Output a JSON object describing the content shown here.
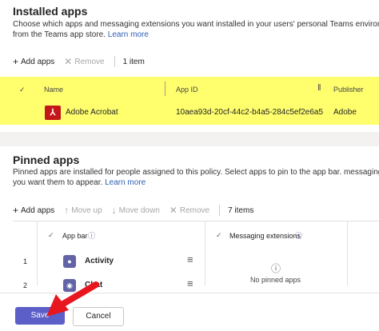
{
  "installed": {
    "title": "Installed apps",
    "desc_line1": "Choose which apps and messaging extensions you want installed in your users' personal Teams environment and",
    "desc_line2": "from the Teams app store.",
    "learn_more": "Learn more",
    "toolbar": {
      "add": "Add apps",
      "remove": "Remove",
      "count": "1 item"
    },
    "columns": {
      "name": "Name",
      "app_id": "App ID",
      "publisher": "Publisher"
    },
    "rows": [
      {
        "name": "Adobe Acrobat",
        "app_id": "10aea93d-20cf-44c2-b4a5-284c5ef2e6a5",
        "publisher": "Adobe"
      }
    ]
  },
  "pinned": {
    "title": "Pinned apps",
    "desc_line1": "Pinned apps are installed for people assigned to this policy. Select apps to pin to the app bar. messaging extensi",
    "desc_line2": "you want them to appear.",
    "learn_more": "Learn more",
    "toolbar": {
      "add": "Add apps",
      "up": "Move up",
      "down": "Move down",
      "remove": "Remove",
      "count": "7 items"
    },
    "columns": {
      "app_bar": "App bar",
      "messaging": "Messaging extensions"
    },
    "rows": [
      {
        "index": "1",
        "name": "Activity"
      },
      {
        "index": "2",
        "name": "Chat"
      }
    ],
    "empty": "No pinned apps"
  },
  "footer": {
    "save": "Save",
    "cancel": "Cancel"
  },
  "colors": {
    "highlight": "#ffff6e",
    "accent": "#6264a7",
    "arrow": "#e8171f"
  }
}
